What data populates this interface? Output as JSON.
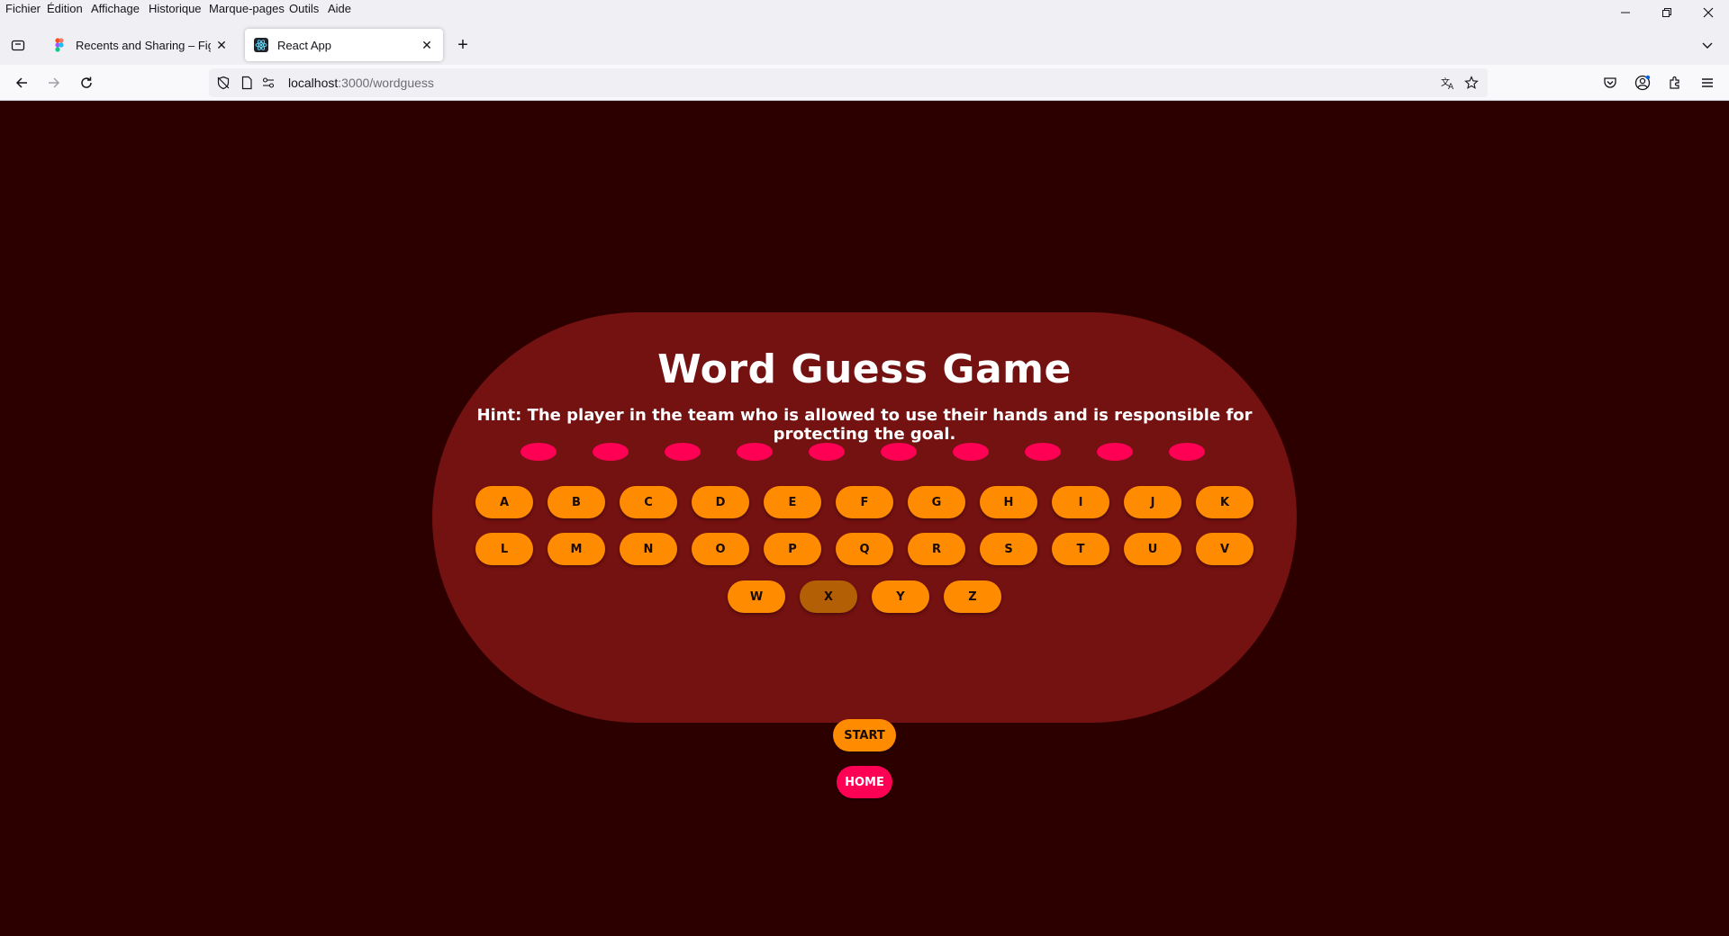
{
  "browser": {
    "menu": [
      "Fichier",
      "Édition",
      "Affichage",
      "Historique",
      "Marque-pages",
      "Outils",
      "Aide"
    ],
    "tabs": [
      {
        "title": "Recents and Sharing – Figma",
        "favicon": "figma-icon",
        "active": false
      },
      {
        "title": "React App",
        "favicon": "react-icon",
        "active": true
      }
    ],
    "url": {
      "host": "localhost",
      "rest": ":3000/wordguess"
    },
    "colors": {
      "chrome": "#f0f0f4",
      "urlbar": "#f0f0f4"
    }
  },
  "game": {
    "title": "Word Guess Game",
    "hint": "Hint: The player in the team who is allowed to use their hands and is responsible for protecting the goal.",
    "slot_count": 10,
    "row1": [
      "A",
      "B",
      "C",
      "D",
      "E",
      "F",
      "G",
      "H",
      "I",
      "J",
      "K"
    ],
    "row2": [
      "L",
      "M",
      "N",
      "O",
      "P",
      "Q",
      "R",
      "S",
      "T",
      "U",
      "V"
    ],
    "row3": [
      "W",
      "X",
      "Y",
      "Z"
    ],
    "used_letters": [
      "X"
    ],
    "start_label": "START",
    "home_label": "HOME",
    "colors": {
      "background": "#2d0000",
      "card": "#741111",
      "key": "#ff8c00",
      "key_used": "#b35f05",
      "slot": "#ff0055",
      "home": "#ff0055"
    }
  }
}
